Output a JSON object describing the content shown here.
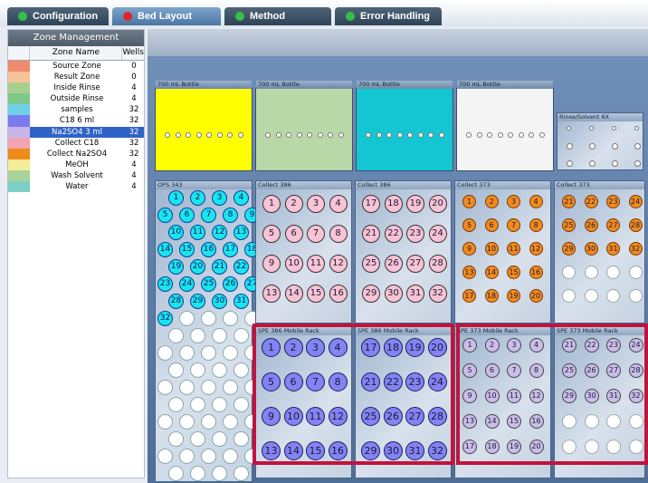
{
  "tabs": [
    {
      "label": "Configuration",
      "dot": "#35c04a"
    },
    {
      "label": "Bed Layout",
      "dot": "#e0252a"
    },
    {
      "label": "Method",
      "dot": "#35c04a"
    },
    {
      "label": "Error Handling",
      "dot": "#35c04a"
    }
  ],
  "zone_panel": {
    "title": "Zone Management",
    "col_name": "Zone Name",
    "col_wells": "Wells",
    "rows": [
      {
        "name": "Source Zone",
        "wells": "0",
        "color": "#f08a6c"
      },
      {
        "name": "Result Zone",
        "wells": "0",
        "color": "#f6c39a"
      },
      {
        "name": "Inside Rinse",
        "wells": "4",
        "color": "#a8cf8e"
      },
      {
        "name": "Outside Rinse",
        "wells": "4",
        "color": "#7dc98a"
      },
      {
        "name": "samples",
        "wells": "32",
        "color": "#6fd0e8"
      },
      {
        "name": "C18 6 ml",
        "wells": "32",
        "color": "#7b7bf0"
      },
      {
        "name": "Na2SO4 3 ml",
        "wells": "32",
        "color": "#c8b5e8",
        "selected": true
      },
      {
        "name": "Collect C18",
        "wells": "32",
        "color": "#f4a3b4"
      },
      {
        "name": "Collect Na2SO4",
        "wells": "32",
        "color": "#f08a18"
      },
      {
        "name": "MeOH",
        "wells": "4",
        "color": "#f3ee98"
      },
      {
        "name": "Wash Solvent",
        "wells": "4",
        "color": "#a9d39b"
      },
      {
        "name": "Water",
        "wells": "4",
        "color": "#7ed0c6"
      }
    ]
  },
  "bottles": [
    {
      "label": "700 mL Bottle",
      "color": "#ffff00"
    },
    {
      "label": "700 mL Bottle",
      "color": "#b9d8a8"
    },
    {
      "label": "700 mL Bottle",
      "color": "#14c6d2"
    },
    {
      "label": "700 mL Bottle",
      "color": "#f4f4f4"
    }
  ],
  "rinse_label": "Rinse/Solvent 6X",
  "racks": {
    "samples": {
      "label": "OPS 343",
      "color": "#18e6ee",
      "text": "#101060",
      "numbers": [
        "1",
        "2",
        "3",
        "4",
        "5",
        "6",
        "7",
        "8",
        "9",
        "10",
        "11",
        "12",
        "13",
        "14",
        "15",
        "16",
        "17",
        "18",
        "19",
        "20",
        "21",
        "22",
        "23",
        "24",
        "25",
        "26",
        "27",
        "28",
        "29",
        "30",
        "31",
        "32"
      ]
    },
    "collect_a": {
      "label": "Collect 386",
      "color": "#f8c3d4",
      "numbers": [
        "1",
        "2",
        "3",
        "4",
        "5",
        "6",
        "7",
        "8",
        "9",
        "10",
        "11",
        "12",
        "13",
        "14",
        "15",
        "16"
      ]
    },
    "collect_b": {
      "label": "Collect 386",
      "color": "#f8c3d4",
      "numbers": [
        "17",
        "18",
        "19",
        "20",
        "21",
        "22",
        "23",
        "24",
        "25",
        "26",
        "27",
        "28",
        "29",
        "30",
        "31",
        "32"
      ]
    },
    "collect_c": {
      "label": "Collect 373",
      "color": "#f28a1e",
      "numbers": [
        "1",
        "2",
        "3",
        "4",
        "5",
        "6",
        "7",
        "8",
        "9",
        "10",
        "11",
        "12",
        "13",
        "14",
        "15",
        "16",
        "17",
        "18",
        "19",
        "20"
      ]
    },
    "collect_d": {
      "label": "Collect 373",
      "color": "#f28a1e",
      "numbers": [
        "21",
        "22",
        "23",
        "24",
        "25",
        "26",
        "27",
        "28",
        "29",
        "30",
        "31",
        "32"
      ]
    },
    "spe_a": {
      "label": "SPE 386 Mobile Rack",
      "color": "#8383f4",
      "numbers": [
        "1",
        "2",
        "3",
        "4",
        "5",
        "6",
        "7",
        "8",
        "9",
        "10",
        "11",
        "12",
        "13",
        "14",
        "15",
        "16"
      ]
    },
    "spe_b": {
      "label": "SPE 386 Mobile Rack",
      "color": "#8383f4",
      "numbers": [
        "17",
        "18",
        "19",
        "20",
        "21",
        "22",
        "23",
        "24",
        "25",
        "26",
        "27",
        "28",
        "29",
        "30",
        "31",
        "32"
      ]
    },
    "spe_c": {
      "label": "SPE 373 Mobile Rack",
      "color": "#cabde8",
      "numbers": [
        "1",
        "2",
        "3",
        "4",
        "5",
        "6",
        "7",
        "8",
        "9",
        "10",
        "11",
        "12",
        "13",
        "14",
        "15",
        "16",
        "17",
        "18",
        "19",
        "20"
      ]
    },
    "spe_d": {
      "label": "SPE 373 Mobile Rack",
      "color": "#cabde8",
      "numbers": [
        "21",
        "22",
        "23",
        "24",
        "25",
        "26",
        "27",
        "28",
        "29",
        "30",
        "31",
        "32"
      ]
    }
  }
}
